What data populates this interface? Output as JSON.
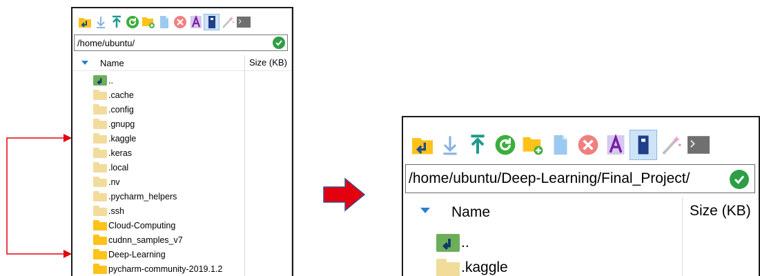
{
  "left": {
    "path": "/home/ubuntu/",
    "columns": {
      "name": "Name",
      "size": "Size (KB)"
    },
    "items": [
      {
        "label": "..",
        "kind": "up"
      },
      {
        "label": ".cache",
        "kind": "hidden"
      },
      {
        "label": ".config",
        "kind": "hidden"
      },
      {
        "label": ".gnupg",
        "kind": "hidden"
      },
      {
        "label": ".kaggle",
        "kind": "hidden"
      },
      {
        "label": ".keras",
        "kind": "hidden"
      },
      {
        "label": ".local",
        "kind": "hidden"
      },
      {
        "label": ".nv",
        "kind": "hidden"
      },
      {
        "label": ".pycharm_helpers",
        "kind": "hidden"
      },
      {
        "label": ".ssh",
        "kind": "hidden"
      },
      {
        "label": "Cloud-Computing",
        "kind": "normal"
      },
      {
        "label": "cudnn_samples_v7",
        "kind": "normal"
      },
      {
        "label": "Deep-Learning",
        "kind": "normal"
      },
      {
        "label": "pycharm-community-2019.1.2",
        "kind": "normal"
      }
    ]
  },
  "right": {
    "path": "/home/ubuntu/Deep-Learning/Final_Project/",
    "columns": {
      "name": "Name",
      "size": "Size (KB)"
    },
    "items": [
      {
        "label": "..",
        "kind": "up"
      },
      {
        "label": ".kaggle",
        "kind": "hidden"
      }
    ]
  },
  "toolbar_icons": [
    "parent-directory-icon",
    "download-icon",
    "upload-icon",
    "refresh-icon",
    "new-folder-icon",
    "new-file-icon",
    "delete-icon",
    "rename-icon",
    "properties-icon",
    "magic-wand-icon",
    "terminal-icon"
  ],
  "colors": {
    "arrow": "#e3000f",
    "go_button": "#2e9e45",
    "accent": "#2b7fd0"
  }
}
